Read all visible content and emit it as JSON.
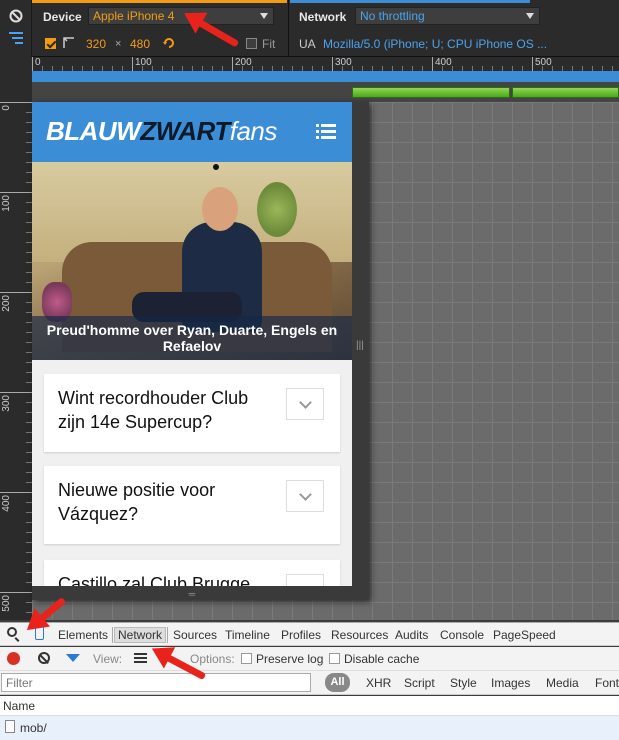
{
  "device_toolbar": {
    "device_label": "Device",
    "device_value": "Apple iPhone 4",
    "width": "320",
    "times": "×",
    "height": "480",
    "fit_label": "Fit",
    "network_label": "Network",
    "network_value": "No throttling",
    "ua_label": "UA",
    "ua_value": "Mozilla/5.0 (iPhone; U; CPU iPhone OS ..."
  },
  "ruler": {
    "h_ticks": [
      "0",
      "100",
      "200",
      "300",
      "400",
      "500"
    ],
    "v_ticks": [
      "0",
      "100",
      "200",
      "300",
      "400",
      "500"
    ]
  },
  "site": {
    "logo_part1": "BLAUW",
    "logo_part2": "ZWART",
    "logo_part3": "fans",
    "hero_caption": "Preud'homme over Ryan, Duarte, Engels en Refaelov",
    "articles": [
      {
        "title": "Wint recordhouder Club zijn 14e Supercup?"
      },
      {
        "title": "Nieuwe positie voor Vázquez?"
      },
      {
        "title": "Castillo zal Club Brugge"
      }
    ],
    "header_color": "#3b8ed6"
  },
  "devtools": {
    "tabs": [
      "Elements",
      "Network",
      "Sources",
      "Timeline",
      "Profiles",
      "Resources",
      "Audits",
      "Console",
      "PageSpeed"
    ],
    "active_tab": "Network",
    "view_label": "View:",
    "options_label": "Options:",
    "preserve_log": "Preserve log",
    "disable_cache": "Disable cache",
    "filter_placeholder": "Filter",
    "filter_types": [
      "All",
      "XHR",
      "Script",
      "Style",
      "Images",
      "Media",
      "Font"
    ],
    "name_header": "Name",
    "rows": [
      {
        "name": "mob/"
      }
    ]
  },
  "colors": {
    "accent_orange": "#f39c12",
    "accent_blue": "#3b8ed6",
    "arrow_red": "#e8231c"
  }
}
